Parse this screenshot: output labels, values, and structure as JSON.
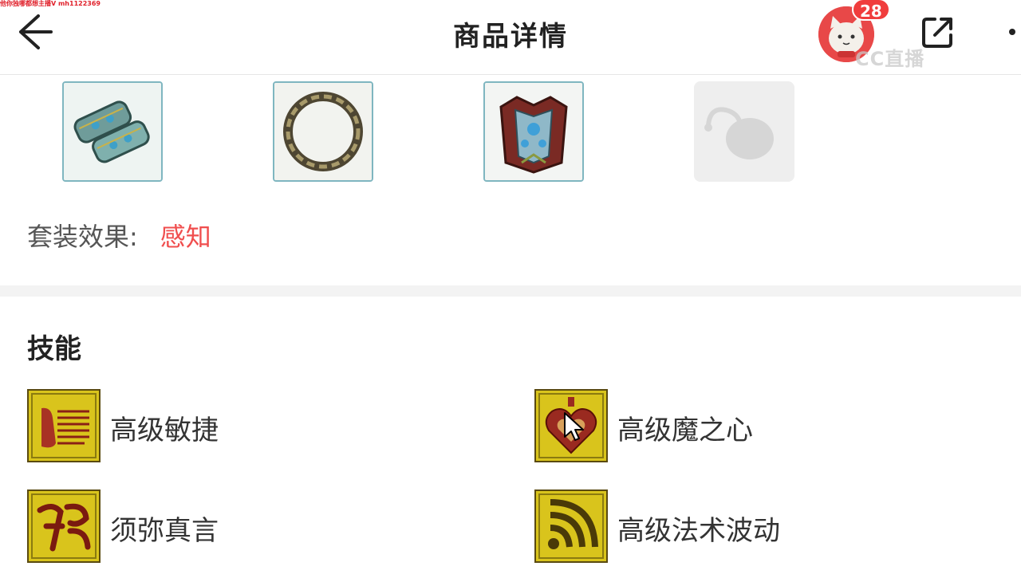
{
  "watermark": "他你独哪都想主播V mh1122369",
  "header": {
    "title": "商品详情",
    "badge_count": "28",
    "live_logo": "CC直播"
  },
  "equipment": {
    "slots": [
      {
        "name": "bracers",
        "icon": "bracers-icon"
      },
      {
        "name": "ring",
        "icon": "ring-icon"
      },
      {
        "name": "armor",
        "icon": "armor-icon"
      },
      {
        "name": "empty",
        "icon": "empty-pouch-icon"
      }
    ]
  },
  "set_effect": {
    "label": "套装效果:",
    "value": "感知",
    "value_color": "#f04e4e"
  },
  "skills": {
    "heading": "技能",
    "items": [
      {
        "name": "高级敏捷",
        "icon": "agility-skill-icon"
      },
      {
        "name": "高级魔之心",
        "icon": "demon-heart-skill-icon"
      },
      {
        "name": "须弥真言",
        "icon": "sumeru-mantra-skill-icon"
      },
      {
        "name": "高级法术波动",
        "icon": "spell-wave-skill-icon"
      }
    ]
  }
}
